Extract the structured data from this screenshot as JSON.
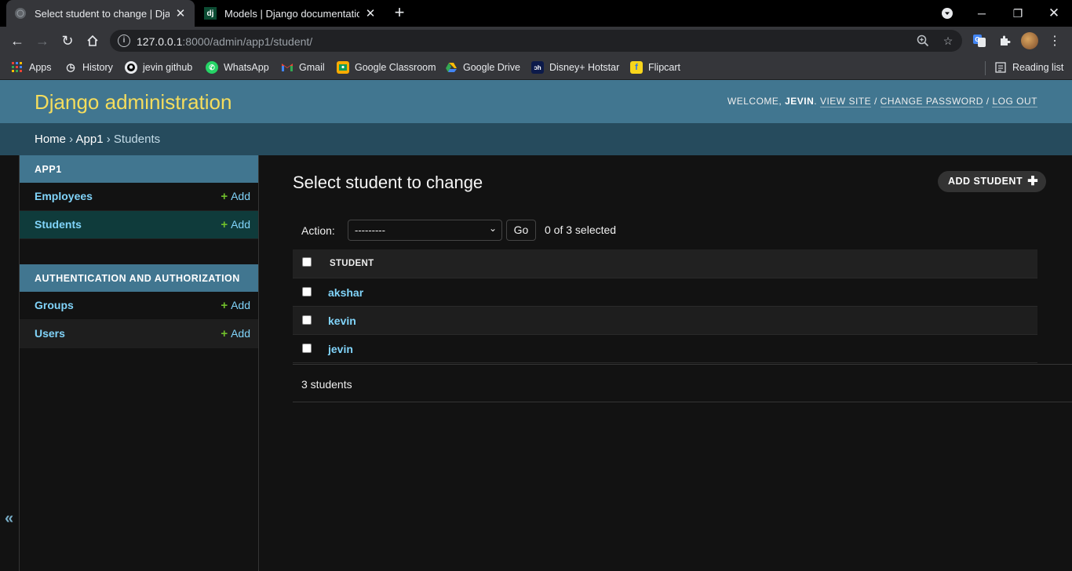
{
  "browser": {
    "tabs": [
      {
        "title": "Select student to change | Django",
        "active": true
      },
      {
        "title": "Models | Django documentation",
        "active": false,
        "favicon_text": "dj"
      }
    ],
    "url": {
      "host": "127.0.0.1",
      "path": ":8000/admin/app1/student/"
    },
    "bookmarks": [
      {
        "label": "Apps",
        "icon": "apps-grid-icon"
      },
      {
        "label": "History",
        "icon": "history-icon"
      },
      {
        "label": "jevin github",
        "icon": "github-icon"
      },
      {
        "label": "WhatsApp",
        "icon": "whatsapp-icon"
      },
      {
        "label": "Gmail",
        "icon": "gmail-icon"
      },
      {
        "label": "Google Classroom",
        "icon": "classroom-icon"
      },
      {
        "label": "Google Drive",
        "icon": "drive-icon"
      },
      {
        "label": "Disney+ Hotstar",
        "icon": "hotstar-icon"
      },
      {
        "label": "Flipcart",
        "icon": "flipkart-icon"
      }
    ],
    "reading_list": "Reading list"
  },
  "header": {
    "branding": "Django administration",
    "welcome": "WELCOME,",
    "username": "JEVIN",
    "view_site": "VIEW SITE",
    "change_password": "CHANGE PASSWORD",
    "log_out": "LOG OUT"
  },
  "breadcrumbs": {
    "home": "Home",
    "app": "App1",
    "current": "Students"
  },
  "sidebar": {
    "modules": [
      {
        "caption": "APP1",
        "models": [
          {
            "name": "Employees",
            "add": "Add"
          },
          {
            "name": "Students",
            "add": "Add"
          }
        ]
      },
      {
        "caption": "AUTHENTICATION AND AUTHORIZATION",
        "models": [
          {
            "name": "Groups",
            "add": "Add"
          },
          {
            "name": "Users",
            "add": "Add"
          }
        ]
      }
    ],
    "toggle": "«"
  },
  "content": {
    "title": "Select student to change",
    "add_button": "ADD STUDENT",
    "action_label": "Action:",
    "action_selected": "---------",
    "go": "Go",
    "counter": "0 of 3 selected",
    "column_header": "STUDENT",
    "rows": [
      "akshar",
      "kevin",
      "jevin"
    ],
    "paginator": "3 students"
  },
  "colors": {
    "header_bg": "#417690",
    "branding": "#f5dd5d",
    "breadcrumbs_bg": "#264b5d",
    "link": "#81d4fa",
    "add_plus": "#70bf2b"
  }
}
